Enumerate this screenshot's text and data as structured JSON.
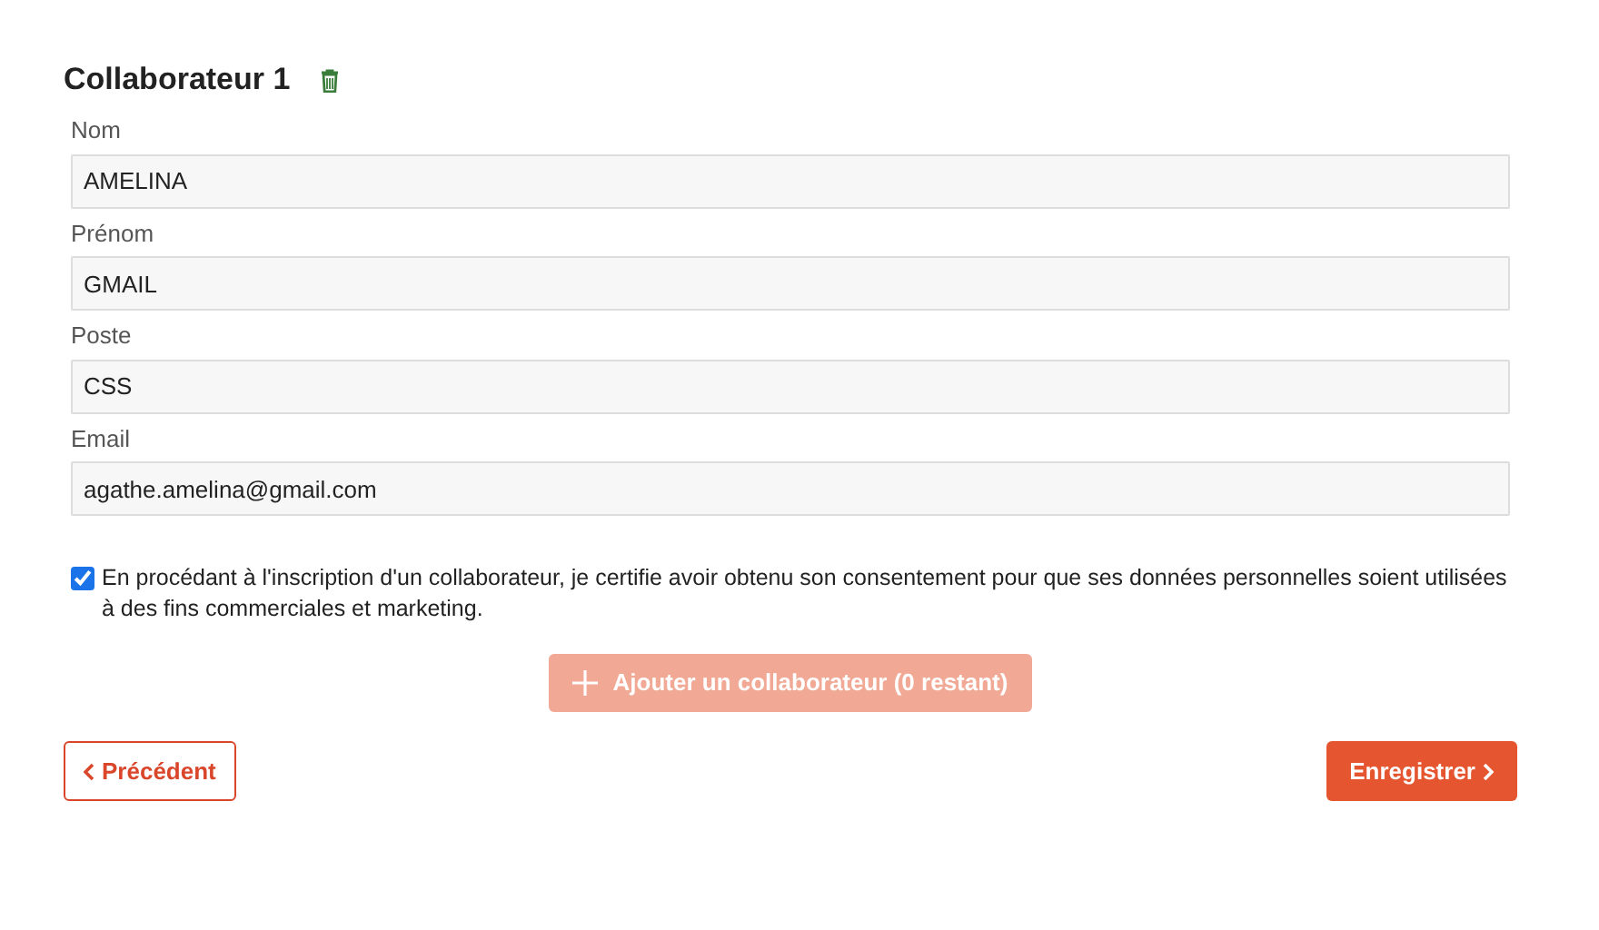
{
  "title": "Collaborateur 1",
  "fields": [
    {
      "label": "Nom",
      "value": "AMELINA"
    },
    {
      "label": "Prénom",
      "value": "GMAIL"
    },
    {
      "label": "Poste",
      "value": "CSS"
    },
    {
      "label": "Email",
      "value": "agathe.amelina@gmail.com"
    }
  ],
  "consent": {
    "checked": true,
    "text": "En procédant à l'inscription d'un collaborateur, je certifie avoir obtenu son consentement pour que ses données personnelles soient utilisées à des fins commerciales et marketing."
  },
  "add_button": {
    "label": "Ajouter un collaborateur (0 restant)",
    "disabled": true
  },
  "previous_button": {
    "label": "Précédent"
  },
  "save_button": {
    "label": "Enregistrer"
  }
}
